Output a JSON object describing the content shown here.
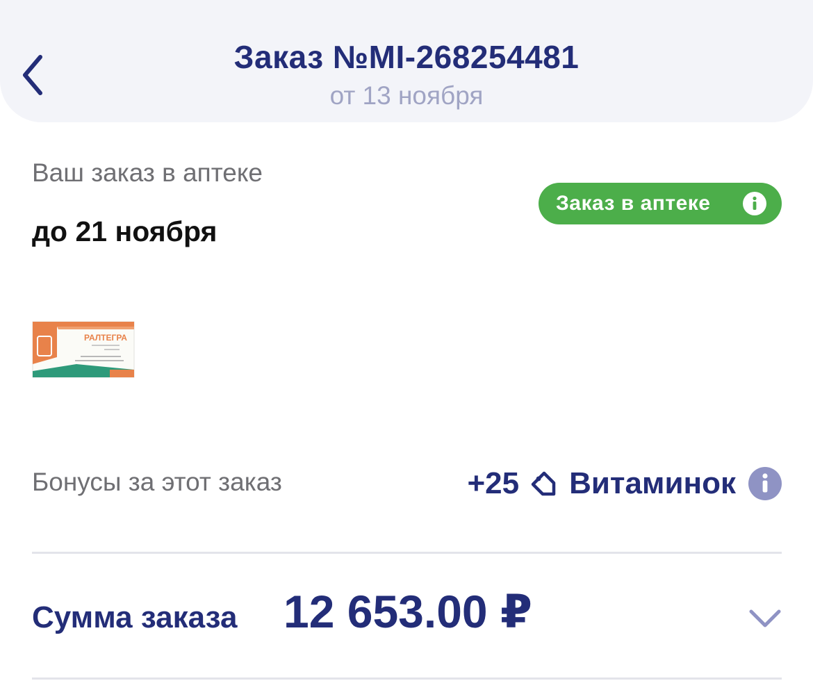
{
  "header": {
    "title": "Заказ №MI-268254481",
    "subtitle": "от 13 ноября",
    "back_icon": "chevron-left-icon"
  },
  "pickup": {
    "label": "Ваш заказ в аптеке",
    "date": "до 21 ноября",
    "status_badge": {
      "label": "Заказ в аптеке",
      "icon": "info-icon",
      "color": "#4cae4a"
    }
  },
  "product": {
    "thumbnail_text": "РАЛТЕГРА",
    "colors": {
      "accent": "#e8824a",
      "secondary": "#2e9a7a"
    }
  },
  "bonus": {
    "label": "Бонусы за этот заказ",
    "amount": "+25",
    "tag_icon": "tag-icon",
    "currency": "Витаминок",
    "info_icon": "info-icon"
  },
  "total": {
    "label": "Сумма заказа",
    "value": "12 653.00 ₽",
    "chevron_icon": "chevron-down-icon"
  },
  "colors": {
    "primary": "#232d78",
    "muted": "#6f6f73",
    "subtitle": "#a0a4c4",
    "header_bg": "#f3f4f9",
    "success": "#4cae4a",
    "info_muted": "#8f93c4"
  }
}
